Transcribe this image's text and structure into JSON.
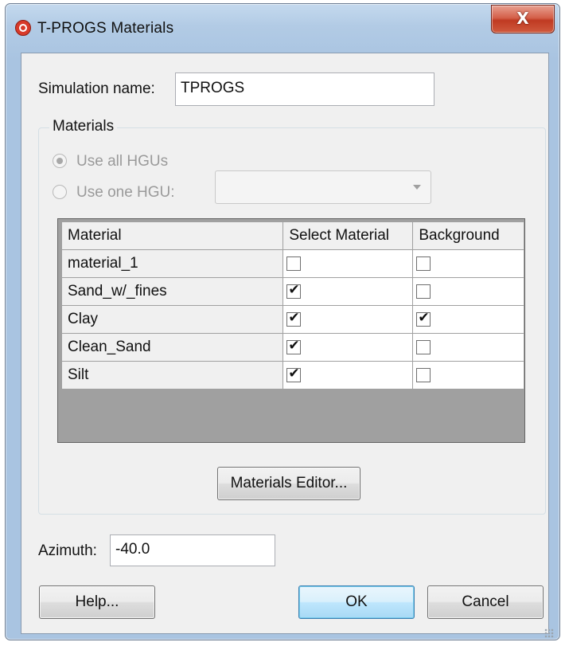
{
  "window": {
    "title": "T-PROGS Materials",
    "close_label": "X"
  },
  "simulation": {
    "label": "Simulation name:",
    "value": "TPROGS"
  },
  "materials_group": {
    "title": "Materials",
    "radio_all": {
      "label": "Use all HGUs",
      "checked": true,
      "enabled": false
    },
    "radio_one": {
      "label": "Use one HGU:",
      "checked": false,
      "enabled": false
    },
    "hgu_combo": {
      "value": "",
      "enabled": false
    }
  },
  "table": {
    "headers": [
      "Material",
      "Select Material",
      "Background"
    ],
    "rows": [
      {
        "material": "material_1",
        "select": false,
        "background": false
      },
      {
        "material": "Sand_w/_fines",
        "select": true,
        "background": false
      },
      {
        "material": "Clay",
        "select": true,
        "background": true
      },
      {
        "material": "Clean_Sand",
        "select": true,
        "background": false
      },
      {
        "material": "Silt",
        "select": true,
        "background": false
      }
    ]
  },
  "materials_editor_button": "Materials Editor...",
  "azimuth": {
    "label": "Azimuth:",
    "value": "-40.0"
  },
  "buttons": {
    "help": "Help...",
    "ok": "OK",
    "cancel": "Cancel"
  },
  "colors": {
    "title_bar": "#b2cbe5",
    "client_bg": "#f0f0f0",
    "grid_empty": "#a0a0a0",
    "close_button": "#c8452d",
    "default_button": "#bee6fd"
  }
}
